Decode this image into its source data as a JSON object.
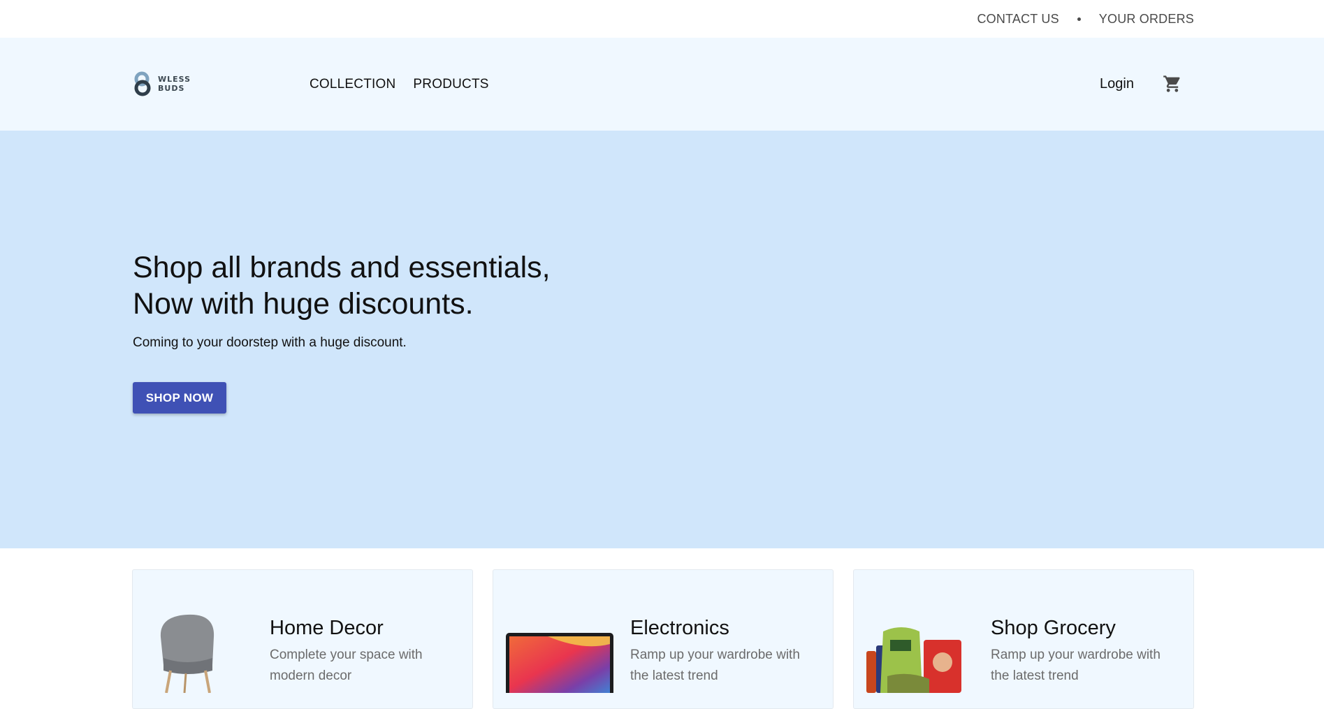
{
  "topbar": {
    "contact_label": "CONTACT US",
    "orders_label": "YOUR ORDERS"
  },
  "header": {
    "logo_line1": "WLESS",
    "logo_line2": "BUDS",
    "nav": [
      {
        "label": "COLLECTION"
      },
      {
        "label": "PRODUCTS"
      }
    ],
    "login_label": "Login",
    "cart_icon": "cart-icon"
  },
  "hero": {
    "title_line1": "Shop all brands and essentials,",
    "title_line2": "Now with huge discounts.",
    "subtitle": "Coming to your doorstep with a huge discount.",
    "cta_label": "SHOP NOW",
    "background_color": "#d0e6fb",
    "cta_color": "#3f51b5"
  },
  "categories": [
    {
      "title": "Home Decor",
      "description": "Complete your space with modern decor",
      "icon": "chair-image"
    },
    {
      "title": "Electronics",
      "description": "Ramp up your wardrobe with the latest trend",
      "icon": "laptop-image"
    },
    {
      "title": "Shop Grocery",
      "description": "Ramp up your wardrobe with the latest trend",
      "icon": "grocery-image"
    }
  ]
}
